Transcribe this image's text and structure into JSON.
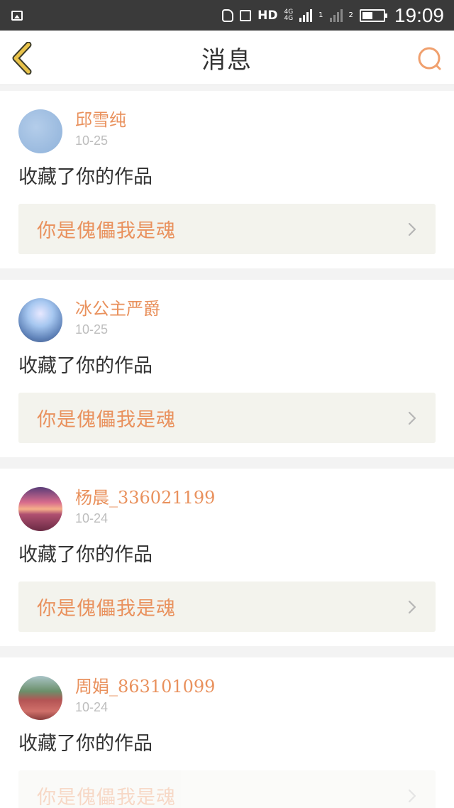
{
  "status_bar": {
    "network_hd": "HD",
    "network_type_1": "4G",
    "network_type_2": "4G",
    "sim_1": "1",
    "sim_2": "2",
    "time": "19:09",
    "battery_level": 0.45
  },
  "nav": {
    "title": "消息",
    "back_icon": "chevron-left-icon",
    "search_icon": "search-icon"
  },
  "messages": [
    {
      "user": "邱雪纯",
      "date": "10-25",
      "action": "收藏了你的作品",
      "work": "你是傀儡我是魂",
      "avatar": "avatar-light-blue"
    },
    {
      "user": "冰公主严爵",
      "date": "10-25",
      "action": "收藏了你的作品",
      "work": "你是傀儡我是魂",
      "avatar": "avatar-anime-girl"
    },
    {
      "user": "杨晨_336021199",
      "date": "10-24",
      "action": "收藏了你的作品",
      "work": "你是傀儡我是魂",
      "avatar": "avatar-sunset"
    },
    {
      "user": "周娟_863101099",
      "date": "10-24",
      "action": "收藏了你的作品",
      "work": "你是傀儡我是魂",
      "avatar": "avatar-flower-field"
    }
  ],
  "colors": {
    "accent": "#e9915d",
    "back_arrow": "#e8c24a",
    "status_bar": "#3a3a3a",
    "work_row_bg": "#f3f3ed"
  }
}
